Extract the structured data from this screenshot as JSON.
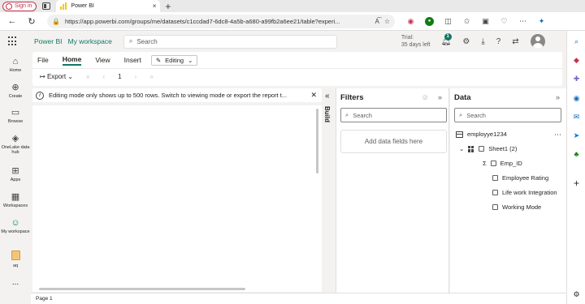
{
  "browser": {
    "signin_label": "Sign in",
    "tab_title": "Power BI",
    "tab_close": "×",
    "new_tab": "+",
    "url": "https://app.powerbi.com/groups/me/datasets/c1ccdad7-6dc8-4a5b-a680-a99fb2a6ee21/table?experi...",
    "back": "←",
    "refresh": "↻",
    "lock": "🔒"
  },
  "header": {
    "brand": "Power BI",
    "workspace": "My workspace",
    "search_placeholder": "Search",
    "trial_line1": "Trial:",
    "trial_line2": "35 days left",
    "notification_count": "1"
  },
  "rail": {
    "items": [
      {
        "label": "Home"
      },
      {
        "label": "Create"
      },
      {
        "label": "Browse"
      },
      {
        "label": "OneLake data hub"
      },
      {
        "label": "Apps"
      },
      {
        "label": "Workspaces"
      },
      {
        "label": "My workspace"
      },
      {
        "label": "aq"
      },
      {
        "label": "..."
      }
    ]
  },
  "ribbon": {
    "tabs": [
      "File",
      "Home",
      "View",
      "Insert"
    ],
    "active_tab": "Home",
    "editing_label": "Editing",
    "export_label": "Export",
    "page_number": "1"
  },
  "notice": {
    "message": "Editing mode only shows up to 500 rows. Switch to viewing mode or export the report t..."
  },
  "build_label": "Build",
  "filters": {
    "title": "Filters",
    "search_placeholder": "Search",
    "add_fields": "Add data fields here"
  },
  "data_pane": {
    "title": "Data",
    "search_placeholder": "Search",
    "dataset": "employye1234",
    "table": "Sheet1 (2)",
    "fields": [
      "Emp_ID",
      "Employee Rating",
      "Life work Integration",
      "Working Mode"
    ]
  },
  "status": {
    "page": "Page 1"
  },
  "colors": {
    "accent": "#117865",
    "signin": "#c4314b"
  }
}
